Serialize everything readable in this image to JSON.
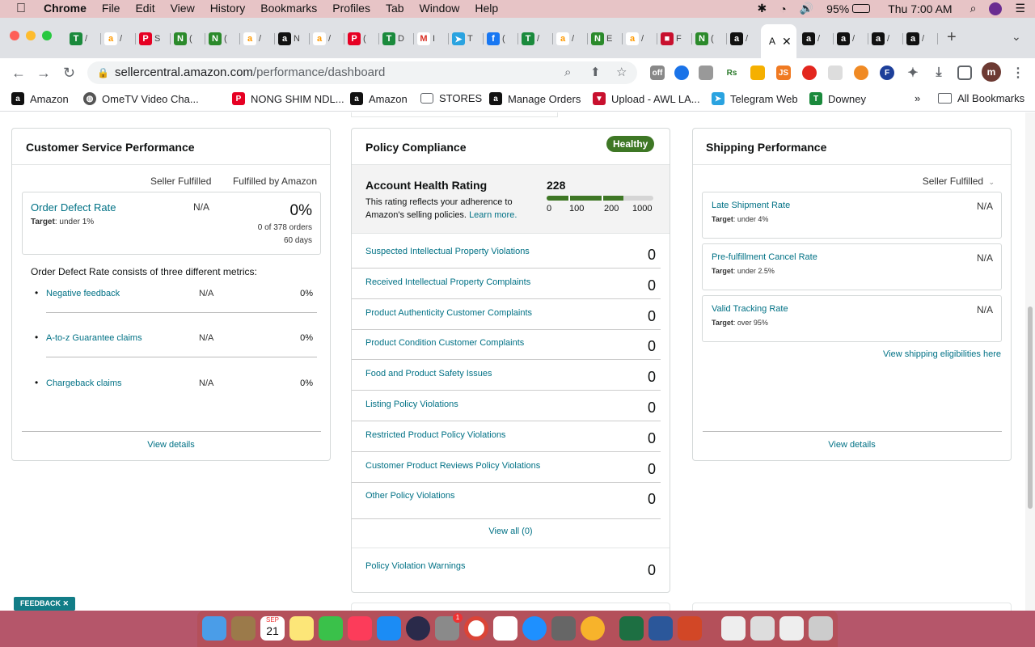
{
  "menubar": {
    "apple_icon": "apple-icon",
    "app_name": "Chrome",
    "menus": [
      "File",
      "Edit",
      "View",
      "History",
      "Bookmarks",
      "Profiles",
      "Tab",
      "Window",
      "Help"
    ],
    "battery": "95%",
    "clock": "Thu 7:00 AM"
  },
  "tabs": {
    "active_label": "A",
    "items": [
      {
        "label": "/",
        "icon": "green-t"
      },
      {
        "label": "/",
        "icon": "amazon"
      },
      {
        "label": "S",
        "icon": "pinterest"
      },
      {
        "label": "(",
        "icon": "green-n"
      },
      {
        "label": "(",
        "icon": "green-n"
      },
      {
        "label": "/",
        "icon": "amazon"
      },
      {
        "label": "N",
        "icon": "amazon-a"
      },
      {
        "label": "/",
        "icon": "amazon"
      },
      {
        "label": "(",
        "icon": "pinterest"
      },
      {
        "label": "D",
        "icon": "green-t"
      },
      {
        "label": "I",
        "icon": "gmail"
      },
      {
        "label": "T",
        "icon": "telegram"
      },
      {
        "label": "(",
        "icon": "facebook"
      },
      {
        "label": "/",
        "icon": "green-t"
      },
      {
        "label": "/",
        "icon": "amazon"
      },
      {
        "label": "E",
        "icon": "green-n"
      },
      {
        "label": "/",
        "icon": "amazon"
      },
      {
        "label": "F",
        "icon": "red"
      },
      {
        "label": "(",
        "icon": "green-n"
      },
      {
        "label": "/",
        "icon": "amazon-a"
      }
    ],
    "after": [
      {
        "label": "/",
        "icon": "amazon-a"
      },
      {
        "label": "/",
        "icon": "amazon-a"
      },
      {
        "label": "/",
        "icon": "amazon-a"
      },
      {
        "label": "/",
        "icon": "amazon-a"
      }
    ]
  },
  "address": {
    "domain": "sellercentral.amazon.com",
    "path": "/performance/dashboard"
  },
  "bookmarks": [
    {
      "label": "Amazon",
      "icon": "amazon-a"
    },
    {
      "label": "OmeTV Video Cha...",
      "icon": "globe"
    },
    {
      "label": "NONG SHIM NDL...",
      "icon": "pinterest"
    },
    {
      "label": "Amazon",
      "icon": "amazon-a"
    },
    {
      "label": "STORES",
      "icon": "folder"
    },
    {
      "label": "Manage Orders",
      "icon": "amazon-a"
    },
    {
      "label": "Upload - AWL LA...",
      "icon": "red-v"
    },
    {
      "label": "Telegram Web",
      "icon": "telegram"
    },
    {
      "label": "Downey",
      "icon": "green-t"
    }
  ],
  "all_bookmarks": "All Bookmarks",
  "csp": {
    "title": "Customer Service Performance",
    "col1": "Seller Fulfilled",
    "col2": "Fulfilled by Amazon",
    "odr_label": "Order Defect Rate",
    "odr_target_prefix": "Target",
    "odr_target": ": under 1%",
    "odr_seller": "N/A",
    "odr_fba": "0%",
    "odr_orders": "0 of 378 orders",
    "odr_days": "60 days",
    "metrics_intro": "Order Defect Rate consists of three different metrics:",
    "metrics": [
      {
        "label": "Negative feedback",
        "seller": "N/A",
        "fba": "0%"
      },
      {
        "label": "A-to-z Guarantee claims",
        "seller": "N/A",
        "fba": "0%"
      },
      {
        "label": "Chargeback claims",
        "seller": "N/A",
        "fba": "0%"
      }
    ],
    "view_details": "View details"
  },
  "policy": {
    "title": "Policy Compliance",
    "badge": "Healthy",
    "ahr_title": "Account Health Rating",
    "ahr_desc": "This rating reflects your adherence to Amazon's selling policies.",
    "learn_more": "Learn more.",
    "ahr_value": "228",
    "ahr_fill_fraction": 0.72,
    "scale": [
      "0",
      "100",
      "200",
      "1000"
    ],
    "items": [
      {
        "label": "Suspected Intellectual Property Violations",
        "value": "0"
      },
      {
        "label": "Received Intellectual Property Complaints",
        "value": "0"
      },
      {
        "label": "Product Authenticity Customer Complaints",
        "value": "0"
      },
      {
        "label": "Product Condition Customer Complaints",
        "value": "0"
      },
      {
        "label": "Food and Product Safety Issues",
        "value": "0"
      },
      {
        "label": "Listing Policy Violations",
        "value": "0"
      },
      {
        "label": "Restricted Product Policy Violations",
        "value": "0"
      },
      {
        "label": "Customer Product Reviews Policy Violations",
        "value": "0"
      },
      {
        "label": "Other Policy Violations",
        "value": "0"
      }
    ],
    "view_all": "View all (0)",
    "warnings_label": "Policy Violation Warnings",
    "warnings_value": "0"
  },
  "shipping": {
    "title": "Shipping Performance",
    "dropdown": "Seller Fulfilled",
    "metrics": [
      {
        "label": "Late Shipment Rate",
        "target_prefix": "Target",
        "target": ": under 4%",
        "value": "N/A"
      },
      {
        "label": "Pre-fulfillment Cancel Rate",
        "target_prefix": "Target",
        "target": ": under 2.5%",
        "value": "N/A"
      },
      {
        "label": "Valid Tracking Rate",
        "target_prefix": "Target",
        "target": ": over 95%",
        "value": "N/A"
      }
    ],
    "eligibility_link": "View shipping eligibilities here",
    "view_details": "View details"
  },
  "feedback": "FEEDBACK",
  "dock": {
    "calendar_day": "21",
    "calendar_month": "SEP",
    "notification_badge": "1"
  }
}
